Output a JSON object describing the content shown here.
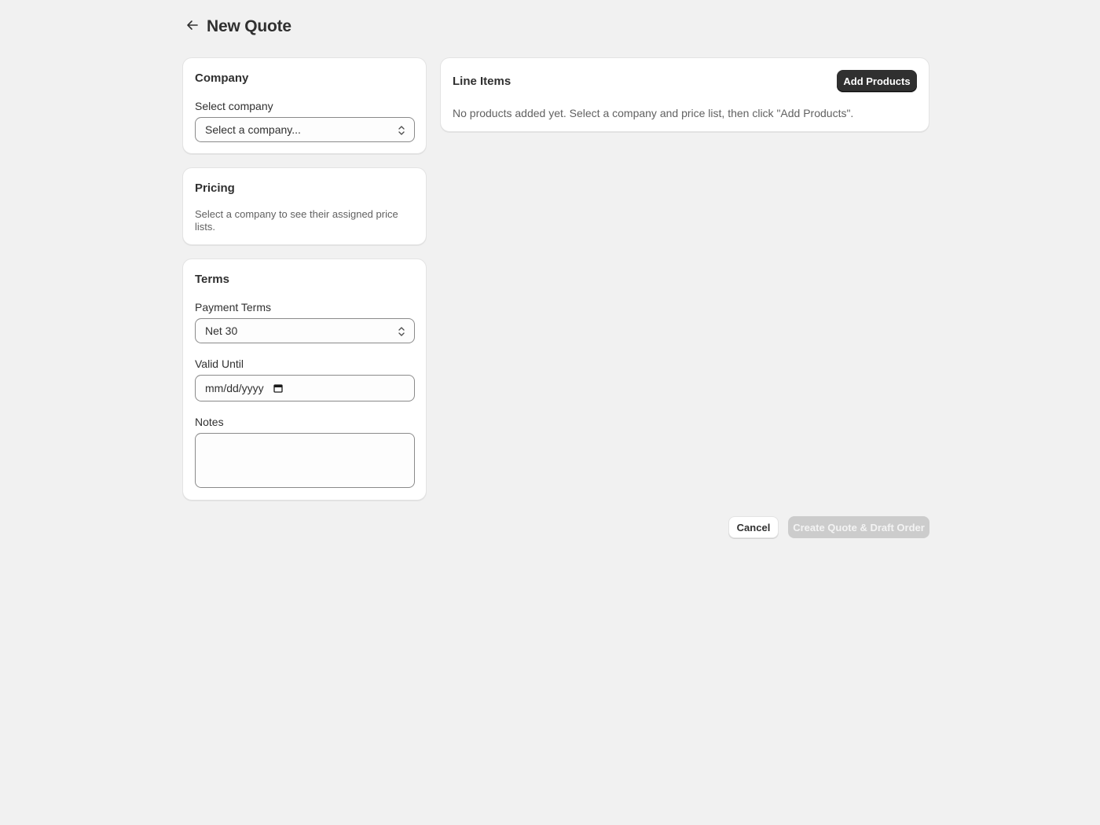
{
  "page": {
    "title": "New Quote"
  },
  "company_card": {
    "title": "Company",
    "select_label": "Select company",
    "select_value": "Select a company..."
  },
  "pricing_card": {
    "title": "Pricing",
    "help_text": "Select a company to see their assigned price lists."
  },
  "terms_card": {
    "title": "Terms",
    "payment_terms_label": "Payment Terms",
    "payment_terms_value": "Net 30",
    "valid_until_label": "Valid Until",
    "valid_until_placeholder": "mm/dd/yyyy",
    "notes_label": "Notes",
    "notes_value": ""
  },
  "line_items_card": {
    "title": "Line Items",
    "add_products_label": "Add Products",
    "empty_text": "No products added yet. Select a company and price list, then click \"Add Products\"."
  },
  "footer": {
    "cancel_label": "Cancel",
    "submit_label": "Create Quote & Draft Order"
  },
  "icons": {
    "back": "arrow-left-icon",
    "select_chevron": "chevron-up-down-icon",
    "calendar": "calendar-icon"
  },
  "colors": {
    "background": "#f1f1f1",
    "card": "#ffffff",
    "primary_button": "#303030",
    "disabled_button": "#cccccc",
    "text": "#303030",
    "muted_text": "#616161"
  }
}
